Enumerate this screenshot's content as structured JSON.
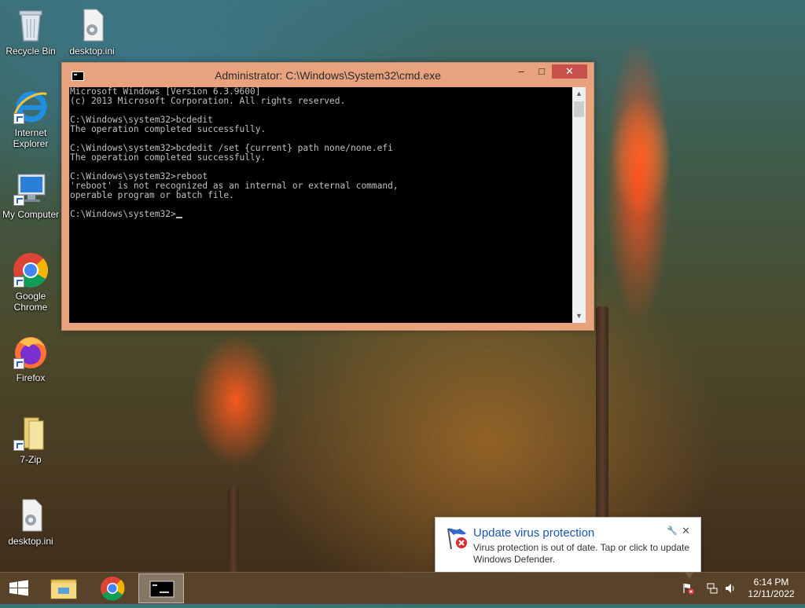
{
  "desktop": {
    "icons": [
      {
        "label": "Recycle Bin"
      },
      {
        "label": "desktop.ini"
      },
      {
        "label": "Internet Explorer"
      },
      {
        "label": "My Computer"
      },
      {
        "label": "Google Chrome"
      },
      {
        "label": "Firefox"
      },
      {
        "label": "7-Zip"
      },
      {
        "label": "desktop.ini"
      }
    ]
  },
  "cmd_window": {
    "title": "Administrator: C:\\Windows\\System32\\cmd.exe",
    "minimize_glyph": "‒",
    "maximize_glyph": "□",
    "close_glyph": "✕",
    "console_text": "Microsoft Windows [Version 6.3.9600]\n(c) 2013 Microsoft Corporation. All rights reserved.\n\nC:\\Windows\\system32>bcdedit\nThe operation completed successfully.\n\nC:\\Windows\\system32>bcdedit /set {current} path none/none.efi\nThe operation completed successfully.\n\nC:\\Windows\\system32>reboot\n'reboot' is not recognized as an internal or external command,\noperable program or batch file.\n\nC:\\Windows\\system32>"
  },
  "notification": {
    "title": "Update virus protection",
    "body": "Virus protection is out of date. Tap or click to update Windows Defender.",
    "close_glyph": "✕",
    "pin_glyph": "🔧"
  },
  "taskbar": {
    "clock_time": "6:14 PM",
    "clock_date": "12/11/2022"
  },
  "colors": {
    "window_frame": "#e8a37e",
    "close_button": "#c7504b",
    "notification_title": "#1a56b0"
  }
}
